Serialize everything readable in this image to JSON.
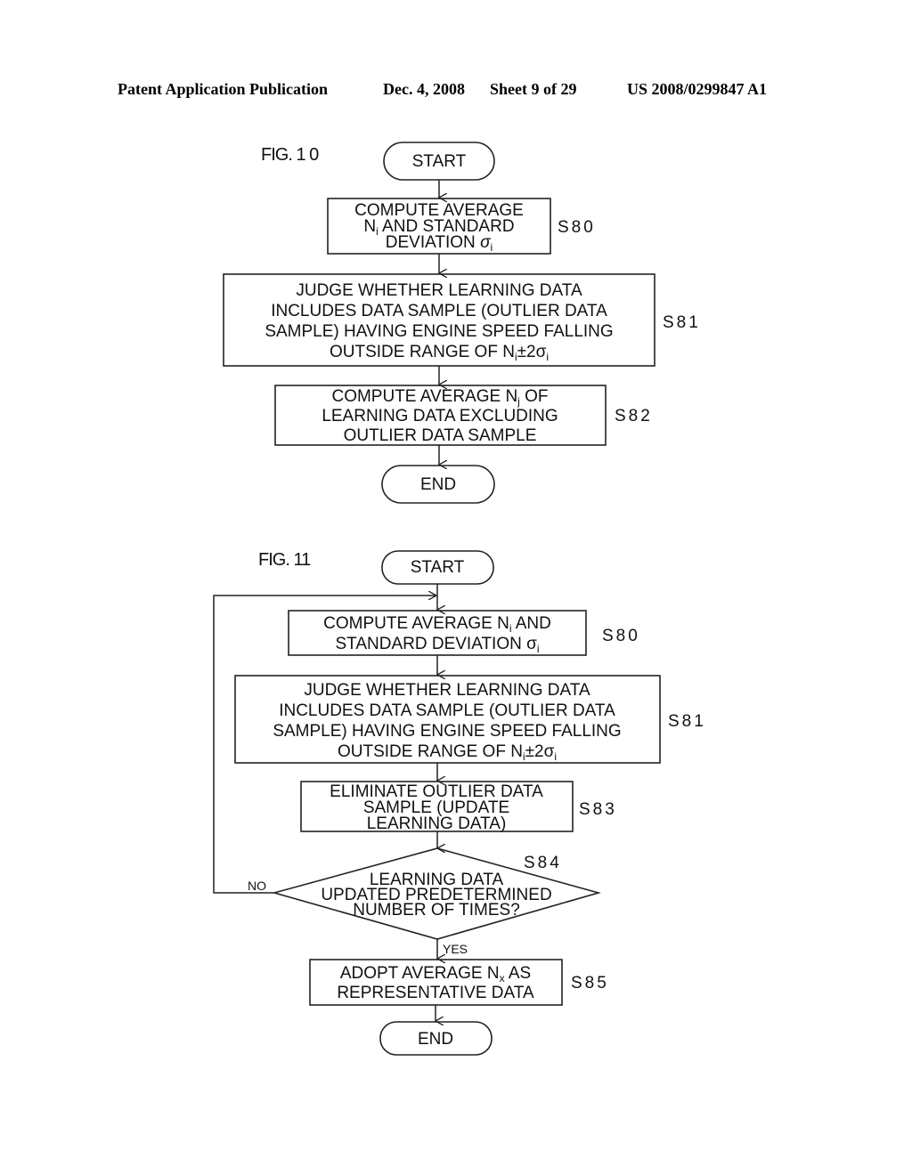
{
  "header": {
    "publication": "Patent Application Publication",
    "date": "Dec. 4, 2008",
    "sheet": "Sheet 9 of 29",
    "number": "US 2008/0299847 A1"
  },
  "fig10": {
    "title": "FIG. 1 0",
    "start": "START",
    "end": "END",
    "s80": {
      "label": "S80",
      "lines": [
        "COMPUTE AVERAGE",
        "N",
        "i",
        " AND STANDARD",
        "DEVIATION ",
        "σ",
        "i"
      ]
    },
    "s81": {
      "label": "S81",
      "lines": [
        "JUDGE WHETHER LEARNING DATA",
        "INCLUDES DATA SAMPLE (OUTLIER DATA",
        "SAMPLE) HAVING ENGINE SPEED FALLING",
        "OUTSIDE RANGE OF N",
        "i",
        "±2σ",
        "i"
      ]
    },
    "s82": {
      "label": "S82",
      "lines": [
        "COMPUTE AVERAGE N",
        "j",
        " OF",
        "LEARNING DATA EXCLUDING",
        "OUTLIER DATA SAMPLE"
      ]
    }
  },
  "fig11": {
    "title": "FIG. 11",
    "start": "START",
    "end": "END",
    "s80": {
      "label": "S80",
      "lines": [
        "COMPUTE AVERAGE N",
        "i",
        " AND",
        "STANDARD DEVIATION σ",
        "i"
      ]
    },
    "s81": {
      "label": "S81",
      "lines": [
        "JUDGE WHETHER LEARNING DATA",
        "INCLUDES DATA SAMPLE (OUTLIER DATA",
        "SAMPLE) HAVING ENGINE SPEED FALLING",
        "OUTSIDE RANGE OF N",
        "i",
        "±2σ",
        "i"
      ]
    },
    "s83": {
      "label": "S83",
      "lines": [
        "ELIMINATE OUTLIER DATA",
        "SAMPLE (UPDATE",
        "LEARNING DATA)"
      ]
    },
    "s84": {
      "label": "S84",
      "lines": [
        "LEARNING DATA",
        "UPDATED PREDETERMINED",
        "NUMBER OF TIMES?"
      ],
      "no": "NO",
      "yes": "YES"
    },
    "s85": {
      "label": "S85",
      "lines": [
        "ADOPT AVERAGE N",
        "x",
        " AS",
        "REPRESENTATIVE DATA"
      ]
    }
  }
}
